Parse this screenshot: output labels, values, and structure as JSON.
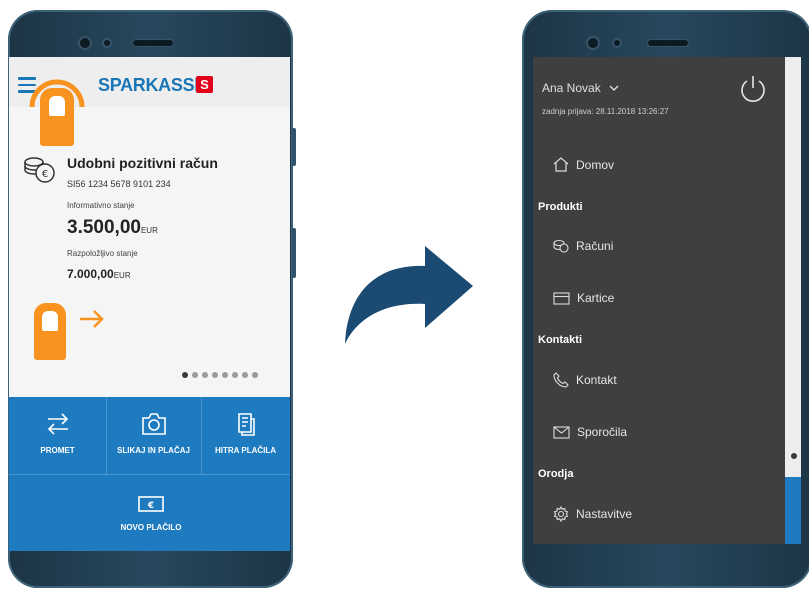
{
  "left_phone": {
    "logo_text": "SPARKASSE",
    "logo_mark": "S",
    "account_name": "Udobni pozitivni račun",
    "iban": "SI56 1234 5678 9101 234",
    "informative_label": "Informativno stanje",
    "informative_amount": "3.500,00",
    "informative_currency": "EUR",
    "available_label": "Razpoložljivo stanje",
    "available_amount": "7.000,00",
    "available_currency": "EUR",
    "carousel_dots": 8,
    "carousel_active": 0,
    "actions": [
      {
        "label": "PROMET",
        "icon": "transfer-arrows-icon"
      },
      {
        "label": "SLIKAJ IN PLAČAJ",
        "icon": "camera-icon"
      },
      {
        "label": "HITRA PLAČILA",
        "icon": "document-icon"
      },
      {
        "label": "NOVO PLAČILO",
        "icon": "banknote-icon"
      }
    ]
  },
  "right_phone": {
    "user_name": "Ana Novak",
    "last_login": "zadnja prijava:  28.11.2018 13:26:27",
    "menu": {
      "home": "Domov",
      "section_products": "Produkti",
      "accounts": "Računi",
      "cards": "Kartice",
      "section_contacts": "Kontakti",
      "contact": "Kontakt",
      "messages": "Sporočila",
      "section_tools": "Orodja",
      "settings": "Nastavitve"
    }
  },
  "colors": {
    "brand_blue": "#1a76b6",
    "action_blue": "#1e7bbf",
    "gesture_orange": "#f7931e",
    "drawer_bg": "#3f3f3f",
    "arrow_blue": "#1b4a72"
  }
}
